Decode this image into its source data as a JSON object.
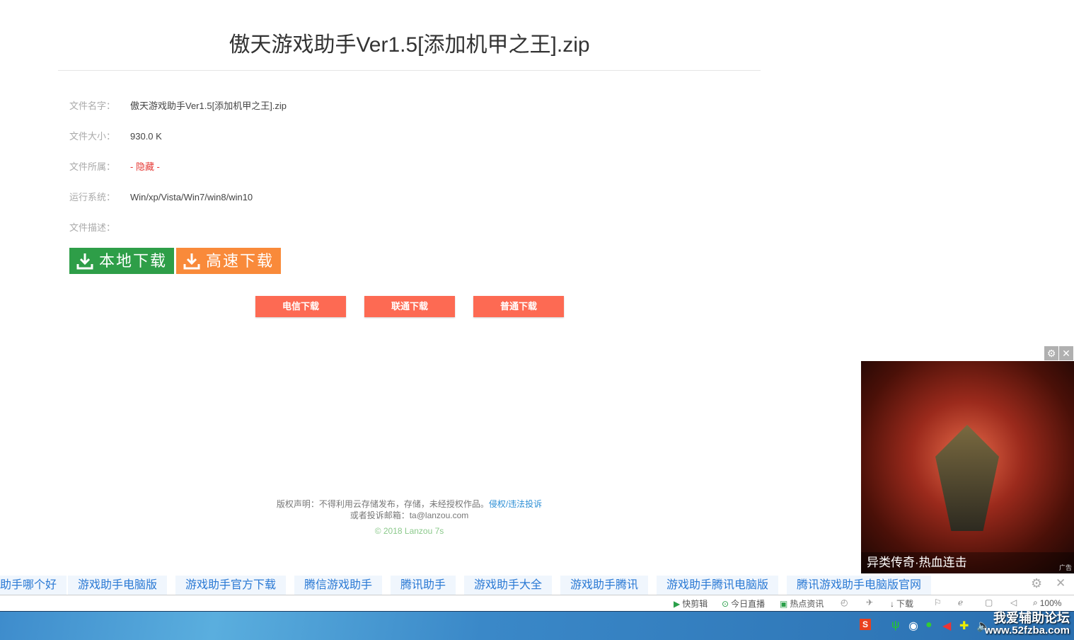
{
  "title": "傲天游戏助手Ver1.5[添加机甲之王].zip",
  "info": [
    {
      "label": "文件名字：",
      "value": "傲天游戏助手Ver1.5[添加机甲之王].zip"
    },
    {
      "label": "文件大小：",
      "value": "930.0 K"
    },
    {
      "label": "文件所属：",
      "value": "- 隐藏 -"
    },
    {
      "label": "运行系统：",
      "value": "Win/xp/Vista/Win7/win8/win10"
    },
    {
      "label": "文件描述：",
      "value": ""
    }
  ],
  "buttons": {
    "local": "本地下载",
    "fast": "高速下载",
    "telecom": "电信下载",
    "unicom": "联通下载",
    "normal": "普通下载"
  },
  "footer": {
    "notice": "版权声明：不得利用云存储发布，存储，未经授权作品。",
    "report": "侵权/违法投诉",
    "email": "或者投诉邮箱：ta@lanzou.com",
    "copyright": "© 2018 Lanzou 7s"
  },
  "ad": {
    "caption": "异类传奇·热血连击",
    "tag": "广告"
  },
  "keywords": [
    "助手哪个好",
    "游戏助手电脑版",
    "游戏助手官方下载",
    "腾信游戏助手",
    "腾讯助手",
    "游戏助手大全",
    "游戏助手腾讯",
    "游戏助手腾讯电脑版",
    "腾讯游戏助手电脑版官网"
  ],
  "statusbar": {
    "clip": "快剪辑",
    "live": "今日直播",
    "news": "热点资讯",
    "download": "下载",
    "zoom": "100%"
  },
  "watermark": {
    "line1": "我爱辅助论坛",
    "line2": "www.52fzba.com"
  },
  "colors": {
    "green": "#2e9e48",
    "orange": "#f98a3a",
    "red_btn": "#fd6a53"
  }
}
